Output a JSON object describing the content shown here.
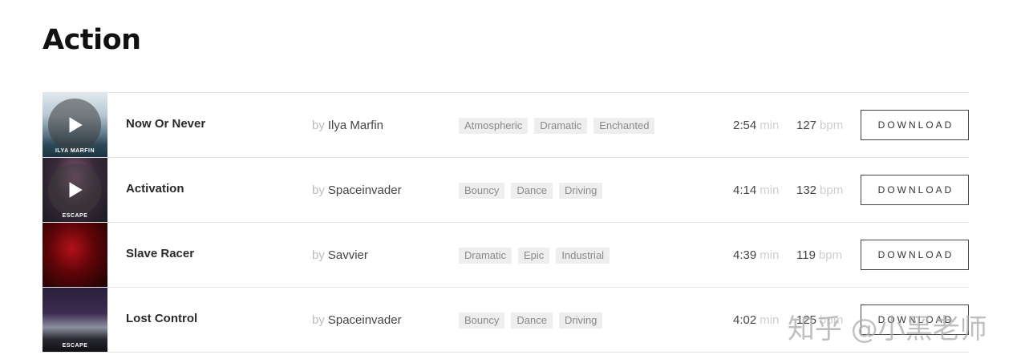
{
  "page": {
    "title": "Action"
  },
  "tracks": [
    {
      "title": "Now Or Never",
      "by_label": "by",
      "artist": "Ilya Marfin",
      "tags": [
        "Atmospheric",
        "Dramatic",
        "Enchanted"
      ],
      "duration": "2:54",
      "duration_unit": "min",
      "bpm": "127",
      "bpm_unit": "bpm",
      "download_label": "DOWNLOAD",
      "cover_text": "ILYA MARFIN"
    },
    {
      "title": "Activation",
      "by_label": "by",
      "artist": "Spaceinvader",
      "tags": [
        "Bouncy",
        "Dance",
        "Driving"
      ],
      "duration": "4:14",
      "duration_unit": "min",
      "bpm": "132",
      "bpm_unit": "bpm",
      "download_label": "DOWNLOAD",
      "cover_text": "ESCAPE"
    },
    {
      "title": "Slave Racer",
      "by_label": "by",
      "artist": "Savvier",
      "tags": [
        "Dramatic",
        "Epic",
        "Industrial"
      ],
      "duration": "4:39",
      "duration_unit": "min",
      "bpm": "119",
      "bpm_unit": "bpm",
      "download_label": "DOWNLOAD",
      "cover_text": ""
    },
    {
      "title": "Lost Control",
      "by_label": "by",
      "artist": "Spaceinvader",
      "tags": [
        "Bouncy",
        "Dance",
        "Driving"
      ],
      "duration": "4:02",
      "duration_unit": "min",
      "bpm": "125",
      "bpm_unit": "bpm",
      "download_label": "DOWNLOAD",
      "cover_text": "ESCAPE"
    }
  ],
  "watermark": "知乎 @小黑老师",
  "colors": {
    "accent_border": "#444444",
    "tag_bg": "#eeeeee",
    "muted": "#bdbdbd"
  }
}
